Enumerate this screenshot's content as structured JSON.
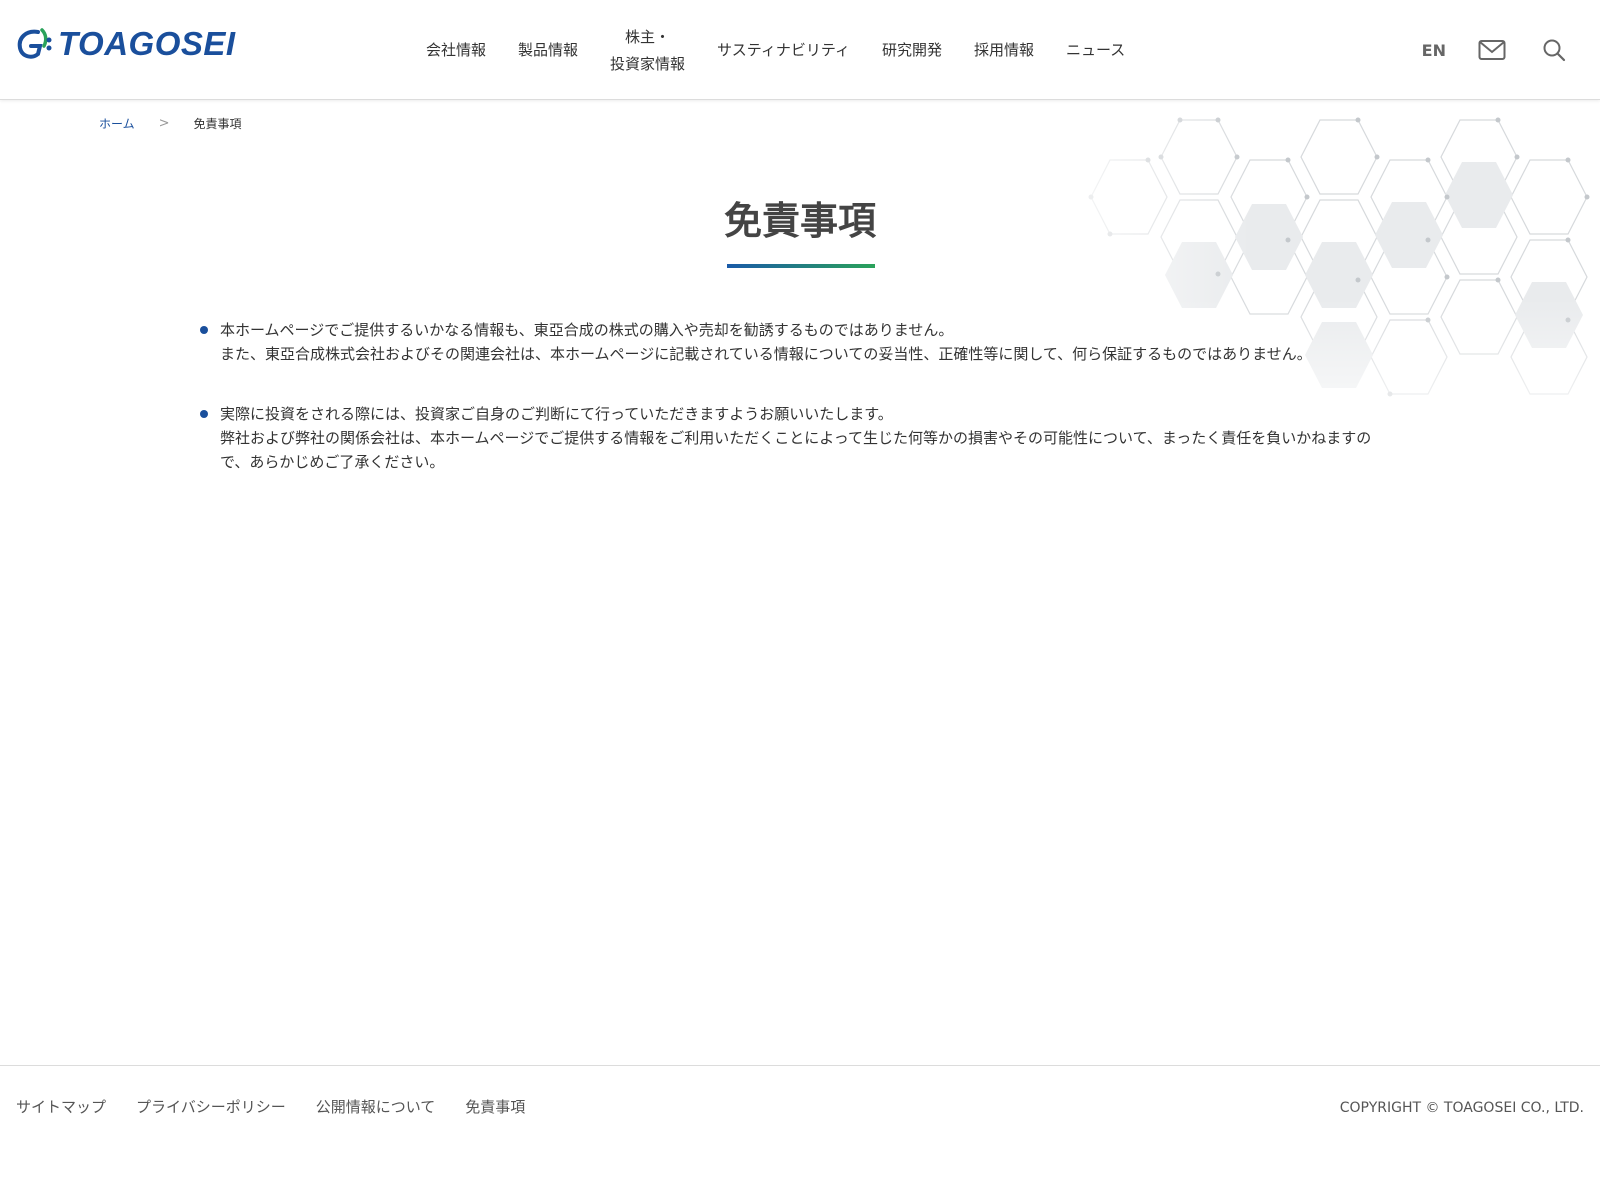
{
  "header": {
    "logo_text": "TOAGOSEI",
    "nav": [
      {
        "label": "会社情報"
      },
      {
        "label": "製品情報"
      },
      {
        "label_line1": "株主・",
        "label_line2": "投資家情報"
      },
      {
        "label": "サスティナビリティ"
      },
      {
        "label": "研究開発"
      },
      {
        "label": "採用情報"
      },
      {
        "label": "ニュース"
      }
    ],
    "lang_label": "EN",
    "icons": [
      "mail-icon",
      "search-icon"
    ]
  },
  "breadcrumb": {
    "home": "ホーム",
    "separator": ">",
    "current": "免責事項"
  },
  "page": {
    "title": "免責事項",
    "items": [
      {
        "line1": "本ホームページでご提供するいかなる情報も、東亞合成の株式の購入や売却を勧誘するものではありません。",
        "line2": "また、東亞合成株式会社およびその関連会社は、本ホームページに記載されている情報についての妥当性、正確性等に関して、何ら保証するものではありません。"
      },
      {
        "line1": "実際に投資をされる際には、投資家ご自身のご判断にて行っていただきますようお願いいたします。",
        "line2": "弊社および弊社の関係会社は、本ホームページでご提供する情報をご利用いただくことによって生じた何等かの損害やその可能性について、まったく責任を負いかねますので、あらかじめご了承ください。"
      }
    ]
  },
  "footer": {
    "links": [
      "サイトマップ",
      "プライバシーポリシー",
      "公開情報について",
      "免責事項"
    ],
    "copyright": "COPYRIGHT © TOAGOSEI CO., LTD."
  },
  "colors": {
    "brand_blue": "#1a4f9c",
    "accent_green": "#2aa25a"
  }
}
